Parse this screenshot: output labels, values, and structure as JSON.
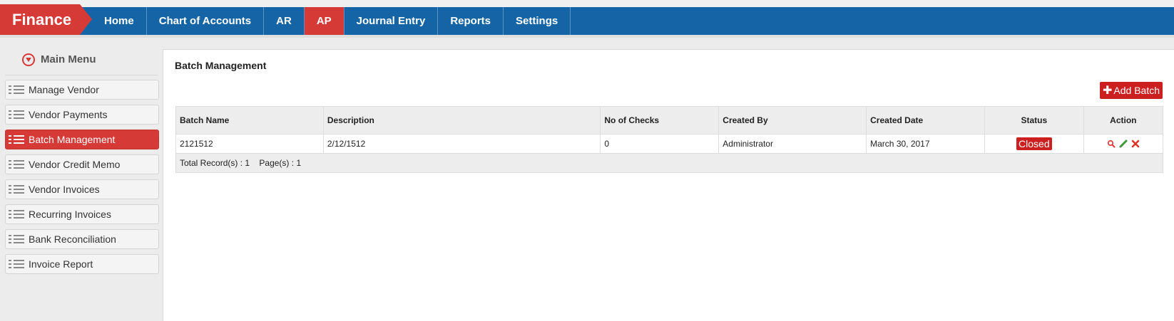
{
  "app": {
    "brand": "Finance"
  },
  "nav": {
    "items": [
      {
        "label": "Home",
        "active": false
      },
      {
        "label": "Chart of Accounts",
        "active": false
      },
      {
        "label": "AR",
        "active": false
      },
      {
        "label": "AP",
        "active": true
      },
      {
        "label": "Journal Entry",
        "active": false
      },
      {
        "label": "Reports",
        "active": false
      },
      {
        "label": "Settings",
        "active": false
      }
    ]
  },
  "sidebar": {
    "title": "Main Menu",
    "items": [
      {
        "label": "Manage Vendor"
      },
      {
        "label": "Vendor Payments"
      },
      {
        "label": "Batch Management",
        "active": true
      },
      {
        "label": "Vendor Credit Memo"
      },
      {
        "label": "Vendor Invoices"
      },
      {
        "label": "Recurring Invoices"
      },
      {
        "label": "Bank Reconciliation"
      },
      {
        "label": "Invoice Report"
      }
    ]
  },
  "main": {
    "title": "Batch Management",
    "add_button": "Add Batch",
    "table": {
      "headers": [
        "Batch Name",
        "Description",
        "No of Checks",
        "Created By",
        "Created Date",
        "Status",
        "Action"
      ],
      "rows": [
        {
          "batch_name": "2121512",
          "description": "2/12/1512",
          "no_of_checks": "0",
          "created_by": "Administrator",
          "created_date": "March 30, 2017",
          "status": "Closed"
        }
      ],
      "footer": {
        "total_label": "Total Record(s) :",
        "total_value": "1",
        "pages_label": "Page(s) :",
        "pages_value": "1"
      }
    }
  },
  "colors": {
    "nav_blue": "#1565a6",
    "brand_red": "#d63a37",
    "button_red": "#cc1f1f"
  }
}
